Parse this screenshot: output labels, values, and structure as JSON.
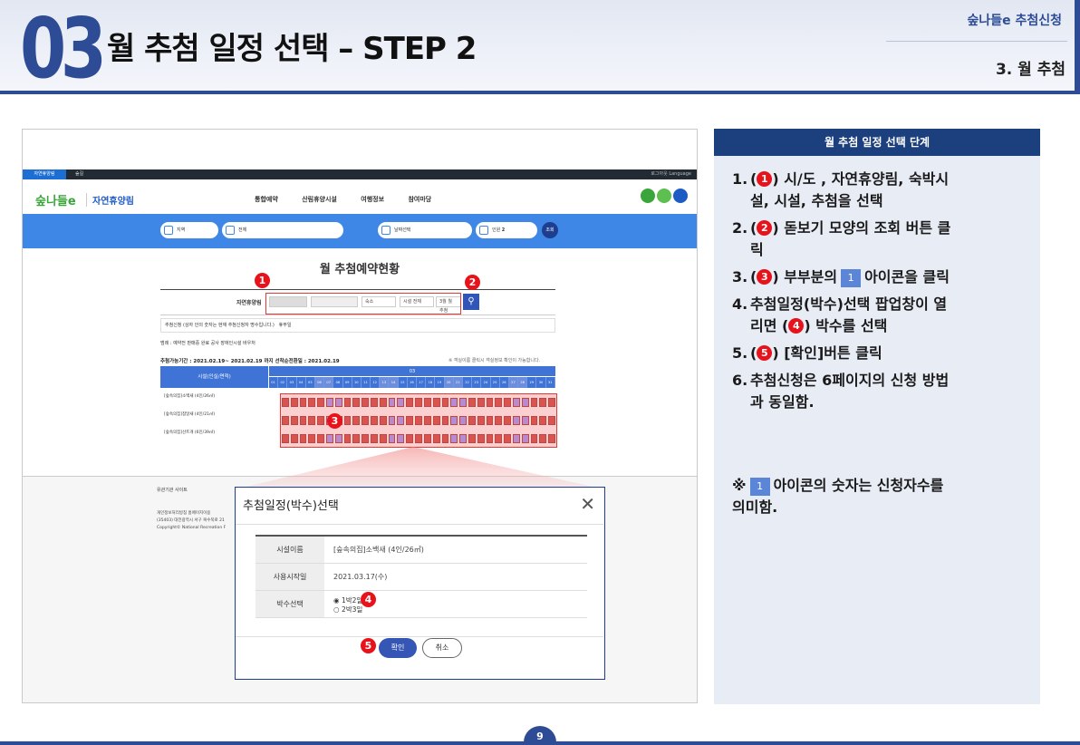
{
  "header": {
    "number": "03",
    "title": "월 추첨 일정 선택 – STEP 2",
    "tag_top": "숲나들e 추첨신청",
    "tag_bottom": "3. 월 추첨"
  },
  "site": {
    "top_tab": "자연휴양림",
    "top_tab2": "숲길",
    "top_right": "로그아웃   Language",
    "logo": "숲나들e",
    "logo_sub": "자연휴양림",
    "nav": [
      "통합예약",
      "산림휴양시설",
      "여행정보",
      "참여마당"
    ],
    "search_pills": [
      "지역",
      "전체",
      "날짜선택",
      "인원"
    ],
    "people_count": "2",
    "search_label": "조회",
    "heading": "월 추첨예약현황",
    "filter_label": "자연휴양림",
    "filter_fields": [
      "숙소",
      "시설 전체",
      "3월 월 추첨"
    ],
    "notice": "추첨신청 (상자 안의 숫자는 현재 추첨신청자 명수입니다.)",
    "notice2": "휴무일",
    "legend": "범례 : 예약전  판매중  완료  공사  장애인시설  바우처",
    "range": "추첨가능기간 : 2021.02.19~ 2021.02.19 까지 선착순전환일 : 2021.02.19",
    "range_note": "※ 객실이름 클릭시 객실정보 확인이 가능합니다.",
    "grid_header": "시설(인실/면적)",
    "grid_month": "03",
    "days": [
      "01",
      "02",
      "03",
      "04",
      "05",
      "06",
      "07",
      "08",
      "09",
      "10",
      "11",
      "12",
      "13",
      "14",
      "15",
      "16",
      "17",
      "18",
      "19",
      "20",
      "21",
      "22",
      "23",
      "24",
      "25",
      "26",
      "27",
      "28",
      "29",
      "30",
      "31"
    ],
    "rows": [
      "[숲속의집]소백새 (4인/26㎡)",
      "[숲속의집]참달새 (4인/21㎡)",
      "[숲속의집]산트개 (6인/39㎡)"
    ],
    "footer_title": "유관기관 사이트",
    "footer_lines": [
      "개인정보처리방침   홈페이지이용",
      "(35403) 대전광역시 서구 복수북로 21",
      "Copyright© National Recreation F"
    ]
  },
  "popup": {
    "title": "추첨일정(박수)선택",
    "close": "✕",
    "rows": [
      {
        "key": "시설이름",
        "value": "[숲속의집]소백새 (4인/26㎡)"
      },
      {
        "key": "사용시작일",
        "value": "2021.03.17(수)"
      },
      {
        "key": "박수선택",
        "value": ""
      }
    ],
    "options": [
      "1박2일",
      "2박3일"
    ],
    "ok": "확인",
    "cancel": "취소"
  },
  "badges": [
    "1",
    "2",
    "3",
    "4",
    "5"
  ],
  "panel": {
    "title": "월 추첨 일정 선택 단계",
    "steps": [
      {
        "n": "1.",
        "pre": "(",
        "badge": "1",
        "post": ") 시/도 , 자연휴양림, 숙박시",
        "line2": "설, 시설, 추첨을 선택"
      },
      {
        "n": "2.",
        "pre": "(",
        "badge": "2",
        "post": ") 돋보기 모양의 조회 버튼 클",
        "line2": "릭"
      },
      {
        "n": "3.",
        "pre": "(",
        "badge": "3",
        "post": ") 부부분의",
        "sq": "1",
        "post2": "아이콘을 클릭"
      },
      {
        "n": "4.",
        "text": "추첨일정(박수)선택 팝업창이 열",
        "line2pre": "리면 (",
        "badge": "4",
        "line2post": ")  박수를 선택"
      },
      {
        "n": "5.",
        "pre": "(",
        "badge": "5",
        "post": ") [확인]버튼 클릭"
      },
      {
        "n": "6.",
        "text": "추첨신청은 6페이지의 신청 방법",
        "line2": "과 동일함."
      }
    ],
    "note_pre": "※",
    "note_sq": "1",
    "note_post": "아이콘의 숫자는 신청자수를",
    "note_line2": "의미함."
  },
  "page_number": "9",
  "colors": {
    "brand": "#2e4c96",
    "panel_head": "#1c3f7e",
    "badge": "#e8121b",
    "site_blue": "#3f87e6"
  }
}
